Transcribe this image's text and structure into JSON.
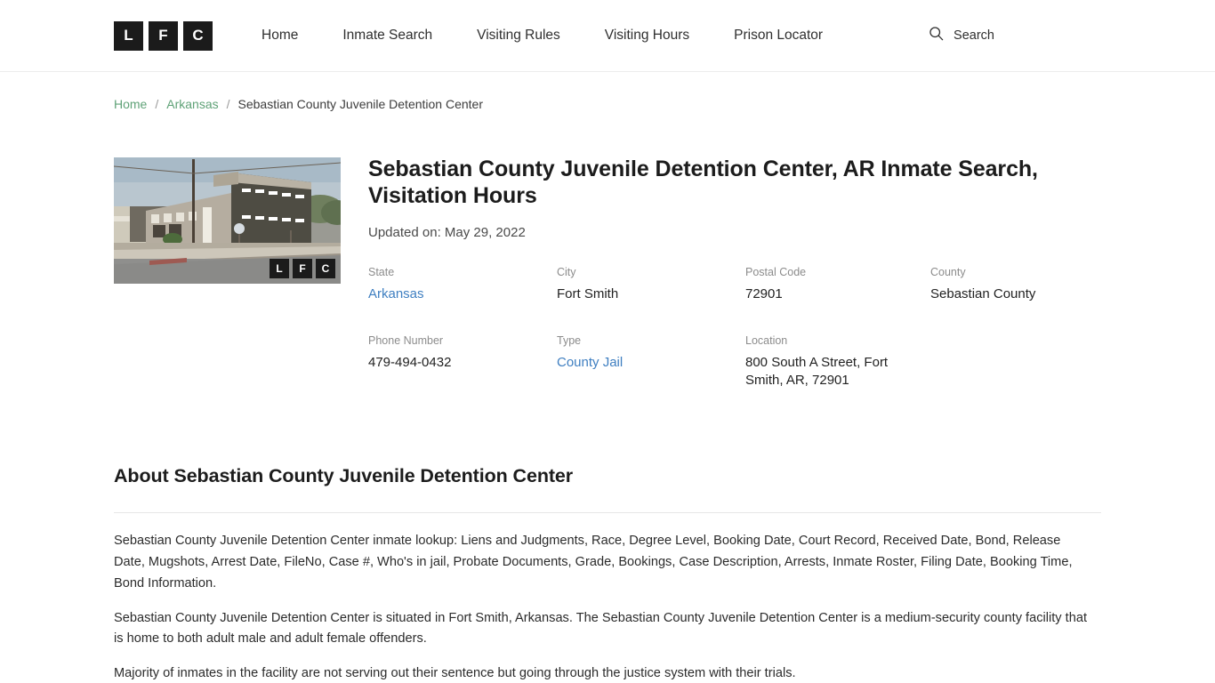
{
  "header": {
    "logo": {
      "tiles": [
        "L",
        "F",
        "C"
      ],
      "name": "LFC"
    },
    "nav": [
      {
        "label": "Home"
      },
      {
        "label": "Inmate Search"
      },
      {
        "label": "Visiting Rules"
      },
      {
        "label": "Visiting Hours"
      },
      {
        "label": "Prison Locator"
      }
    ],
    "search": {
      "label": "Search",
      "icon": "search-icon"
    }
  },
  "breadcrumb": {
    "items": [
      {
        "label": "Home",
        "link": true
      },
      {
        "label": "Arkansas",
        "link": true
      },
      {
        "label": "Sebastian County Juvenile Detention Center",
        "link": false
      }
    ],
    "separator": "/"
  },
  "facility": {
    "photo": {
      "alt": "Sebastian County Juvenile Detention Center building",
      "watermark": [
        "L",
        "F",
        "C"
      ]
    },
    "title": "Sebastian County Juvenile Detention Center, AR Inmate Search, Visitation Hours",
    "updated": "Updated on: May 29, 2022",
    "meta": [
      {
        "label": "State",
        "value": "Arkansas",
        "link": true
      },
      {
        "label": "City",
        "value": "Fort Smith",
        "link": false
      },
      {
        "label": "Postal Code",
        "value": "72901",
        "link": false
      },
      {
        "label": "County",
        "value": "Sebastian County",
        "link": false
      },
      {
        "label": "Phone Number",
        "value": "479-494-0432",
        "link": false
      },
      {
        "label": "Type",
        "value": "County Jail",
        "link": true
      },
      {
        "label": "Location",
        "value": "800 South A Street, Fort Smith, AR, 72901",
        "link": false
      }
    ]
  },
  "about": {
    "heading": "About Sebastian County Juvenile Detention Center",
    "paragraphs": [
      "Sebastian County Juvenile Detention Center inmate lookup: Liens and Judgments, Race, Degree Level, Booking Date, Court Record, Received Date, Bond, Release Date, Mugshots, Arrest Date, FileNo, Case #, Who's in jail, Probate Documents, Grade, Bookings, Case Description, Arrests, Inmate Roster, Filing Date, Booking Time, Bond Information.",
      "Sebastian County Juvenile Detention Center is situated in Fort Smith, Arkansas. The Sebastian County Juvenile Detention Center is a medium-security county facility that is home to both adult male and adult female offenders.",
      "Majority of inmates in the facility are not serving out their sentence but going through the justice system with their trials."
    ]
  },
  "colors": {
    "breadcrumb_link": "#5fa277",
    "data_link": "#3f7fc1",
    "logo_bg": "#1b1b1b",
    "text": "#222222",
    "muted_label": "#8c8c8c",
    "border": "#e6e6e6"
  }
}
